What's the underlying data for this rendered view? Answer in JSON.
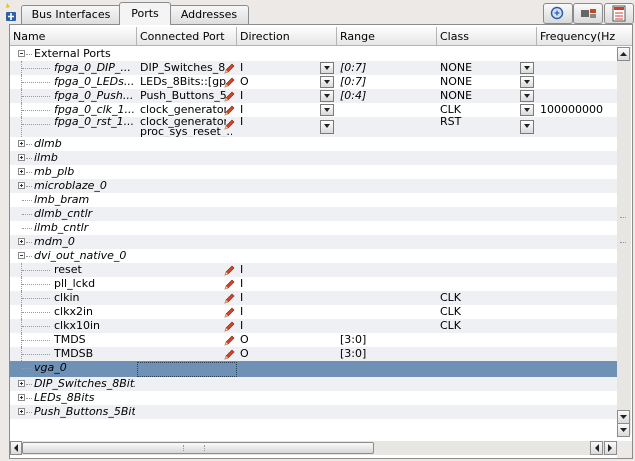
{
  "tabs": [
    {
      "label": "Bus Interfaces",
      "active": false
    },
    {
      "label": "Ports",
      "active": true
    },
    {
      "label": "Addresses",
      "active": false
    }
  ],
  "toolbar": {
    "zoom_icon": "zoom-magnifier-icon",
    "connect_icon": "port-connect-icon",
    "filter_icon": "filter-list-icon"
  },
  "columns": [
    "Name",
    "Connected Port",
    "Direction",
    "Range",
    "Class",
    "Frequency(Hz"
  ],
  "rows": [
    {
      "name": "External Ports",
      "level": 0,
      "expander": "minus",
      "italic": false
    },
    {
      "name": "fpga_0_DIP_...",
      "level": 1,
      "italic": true,
      "connected": "DIP_Switches_8...",
      "pencil": true,
      "dir": "I",
      "dir_dd": true,
      "range": "[0:7]",
      "range_italic": true,
      "class": "NONE",
      "class_dd": true
    },
    {
      "name": "fpga_0_LEDs...",
      "level": 1,
      "italic": true,
      "connected": "LEDs_8Bits::[gpi...",
      "pencil": true,
      "dir": "O",
      "dir_dd": true,
      "range": "[0:7]",
      "range_italic": true,
      "class": "NONE",
      "class_dd": true
    },
    {
      "name": "fpga_0_Push...",
      "level": 1,
      "italic": true,
      "connected": "Push_Buttons_5...",
      "pencil": true,
      "dir": "I",
      "dir_dd": true,
      "range": "[0:4]",
      "range_italic": true,
      "class": "NONE",
      "class_dd": true
    },
    {
      "name": "fpga_0_clk_1...",
      "level": 1,
      "italic": true,
      "connected": "clock_generator...",
      "pencil": true,
      "dir": "I",
      "dir_dd": true,
      "class": "CLK",
      "class_dd": true,
      "freq": "100000000"
    },
    {
      "name": "fpga_0_rst_1...",
      "level": 1,
      "italic": true,
      "connected": "clock_generator...",
      "connected2": "proc_sys_reset_...",
      "pencil": true,
      "dir": "I",
      "dir_dd": true,
      "class": "RST",
      "class_dd": true,
      "tall": true
    },
    {
      "name": "dlmb",
      "level": 0,
      "expander": "plus",
      "italic": true
    },
    {
      "name": "ilmb",
      "level": 0,
      "expander": "plus",
      "italic": true
    },
    {
      "name": "mb_plb",
      "level": 0,
      "expander": "plus",
      "italic": true
    },
    {
      "name": "microblaze_0",
      "level": 0,
      "expander": "plus",
      "italic": true
    },
    {
      "name": "lmb_bram",
      "level": 0,
      "italic": true
    },
    {
      "name": "dlmb_cntlr",
      "level": 0,
      "italic": true
    },
    {
      "name": "ilmb_cntlr",
      "level": 0,
      "italic": true
    },
    {
      "name": "mdm_0",
      "level": 0,
      "expander": "plus",
      "italic": true
    },
    {
      "name": "dvi_out_native_0",
      "level": 0,
      "expander": "minus",
      "italic": true
    },
    {
      "name": "reset",
      "level": 1,
      "italic": false,
      "pencil": true,
      "dir": "I"
    },
    {
      "name": "pll_lckd",
      "level": 1,
      "italic": false,
      "pencil": true,
      "dir": "I"
    },
    {
      "name": "clkin",
      "level": 1,
      "italic": false,
      "pencil": true,
      "dir": "I",
      "class": "CLK"
    },
    {
      "name": "clkx2in",
      "level": 1,
      "italic": false,
      "pencil": true,
      "dir": "I",
      "class": "CLK"
    },
    {
      "name": "clkx10in",
      "level": 1,
      "italic": false,
      "pencil": true,
      "dir": "I",
      "class": "CLK"
    },
    {
      "name": "TMDS",
      "level": 1,
      "italic": false,
      "pencil": true,
      "dir": "O",
      "range": "[3:0]"
    },
    {
      "name": "TMDSB",
      "level": 1,
      "italic": false,
      "pencil": true,
      "dir": "O",
      "range": "[3:0]"
    },
    {
      "name": "vga_0",
      "level": 0,
      "italic": true,
      "selected": true
    },
    {
      "name": "DIP_Switches_8Bits",
      "level": 0,
      "expander": "plus",
      "italic": true
    },
    {
      "name": "LEDs_8Bits",
      "level": 0,
      "expander": "plus",
      "italic": true
    },
    {
      "name": "Push_Buttons_5Bits",
      "level": 0,
      "expander": "plus",
      "italic": true
    }
  ]
}
